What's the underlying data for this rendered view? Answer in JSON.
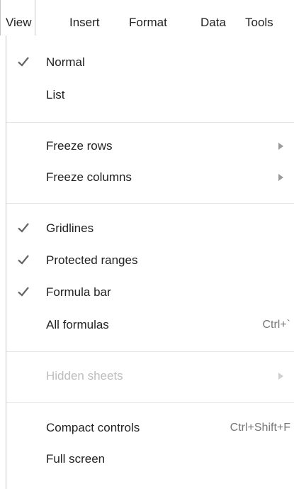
{
  "menubar": {
    "items": [
      {
        "label": "View"
      },
      {
        "label": "Insert"
      },
      {
        "label": "Format"
      },
      {
        "label": "Data"
      },
      {
        "label": "Tools"
      }
    ]
  },
  "menu": {
    "normal": {
      "label": "Normal",
      "checked": true
    },
    "list": {
      "label": "List",
      "checked": false
    },
    "freeze_rows": {
      "label": "Freeze rows",
      "submenu": true
    },
    "freeze_columns": {
      "label": "Freeze columns",
      "submenu": true
    },
    "gridlines": {
      "label": "Gridlines",
      "checked": true
    },
    "protected_ranges": {
      "label": "Protected ranges",
      "checked": true
    },
    "formula_bar": {
      "label": "Formula bar",
      "checked": true
    },
    "all_formulas": {
      "label": "All formulas",
      "shortcut": "Ctrl+`"
    },
    "hidden_sheets": {
      "label": "Hidden sheets",
      "submenu": true,
      "disabled": true
    },
    "compact_controls": {
      "label": "Compact controls",
      "shortcut": "Ctrl+Shift+F"
    },
    "full_screen": {
      "label": "Full screen"
    }
  },
  "colors": {
    "text": "#222222",
    "disabled_text": "#bdbdbd",
    "shortcut_text": "#777777",
    "check": "#666666",
    "separator": "#e5e5e5"
  }
}
